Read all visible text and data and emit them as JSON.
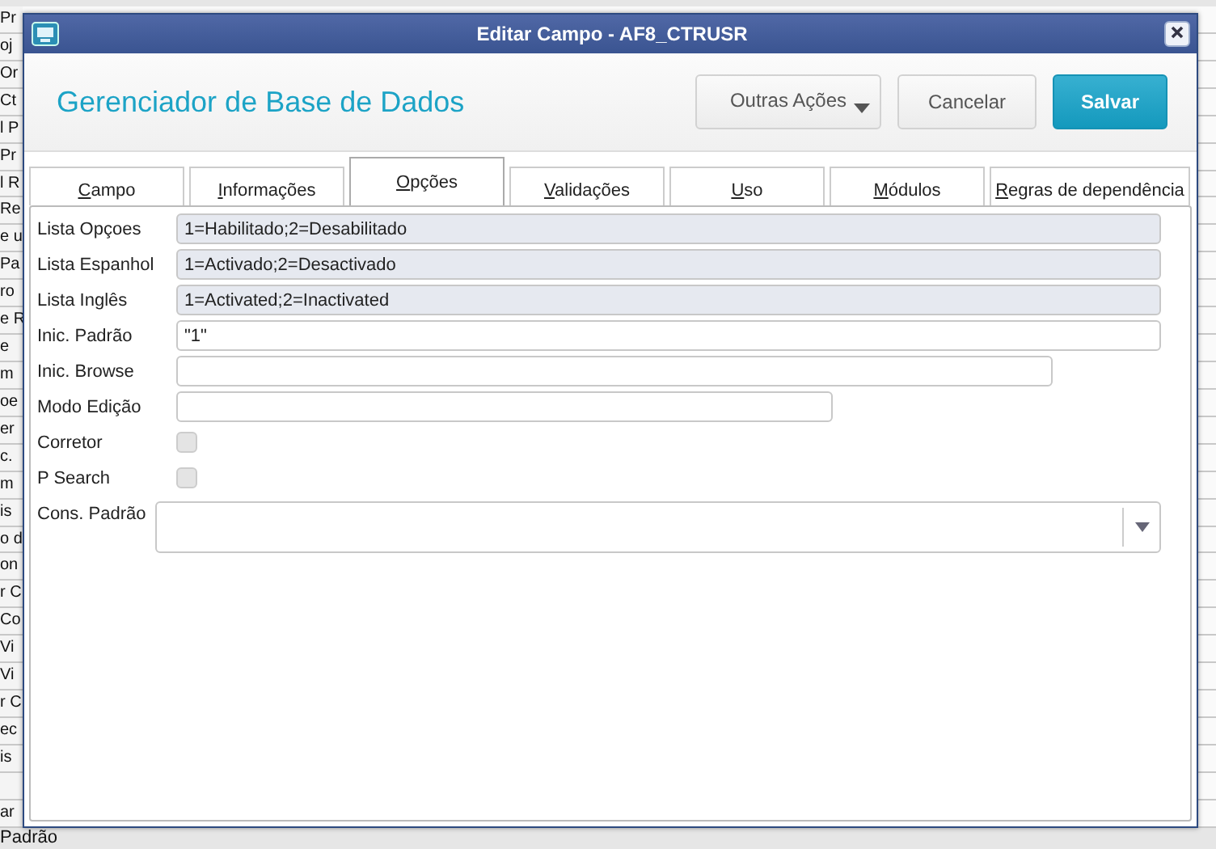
{
  "background_rows": [
    "Pr",
    "oj",
    "Or",
    "Ct",
    "l P",
    "Pr",
    "l R",
    "Re",
    "e u",
    "Pa",
    "ro",
    "e R",
    "e",
    "m",
    "oe",
    "er",
    "c.",
    "m",
    "is",
    "o d",
    "on",
    "r C",
    "Co",
    "Vi",
    "Vi",
    "r C",
    "ec",
    "is",
    "",
    "ar",
    "Padrão"
  ],
  "window": {
    "title": "Editar Campo - AF8_CTRUSR"
  },
  "header": {
    "title": "Gerenciador de Base de Dados",
    "buttons": [
      {
        "label": "Outras Ações",
        "kind": "menu"
      },
      {
        "label": "Cancelar",
        "kind": "secondary"
      },
      {
        "label": "Salvar",
        "kind": "primary"
      }
    ]
  },
  "tabs": [
    {
      "label": "Campo",
      "selected": false
    },
    {
      "label": "Informações",
      "selected": false
    },
    {
      "label": "Opções",
      "selected": true
    },
    {
      "label": "Validações",
      "selected": false
    },
    {
      "label": "Uso",
      "selected": false
    },
    {
      "label": "Módulos",
      "selected": false
    },
    {
      "label": "Regras de dependência",
      "selected": false
    }
  ],
  "fields": [
    {
      "label": "Lista Opçoes",
      "kind": "text",
      "value": "1=Habilitado;2=Desabilitado",
      "readonly": true
    },
    {
      "label": "Lista Espanhol",
      "kind": "text",
      "value": "1=Activado;2=Desactivado",
      "readonly": true
    },
    {
      "label": "Lista Inglês",
      "kind": "text",
      "value": "1=Activated;2=Inactivated",
      "readonly": true
    },
    {
      "label": "Inic. Padrão",
      "kind": "text",
      "value": "\"1\"",
      "readonly": false
    },
    {
      "label": "Inic. Browse",
      "kind": "text",
      "readonly": false
    },
    {
      "label": "Modo Edição",
      "kind": "text",
      "readonly": false
    },
    {
      "label": "Corretor",
      "kind": "checkbox",
      "checked": false,
      "disabled": true
    },
    {
      "label": "P Search",
      "kind": "checkbox",
      "checked": false,
      "disabled": true
    },
    {
      "label": "Cons. Padrão",
      "kind": "combo"
    }
  ]
}
